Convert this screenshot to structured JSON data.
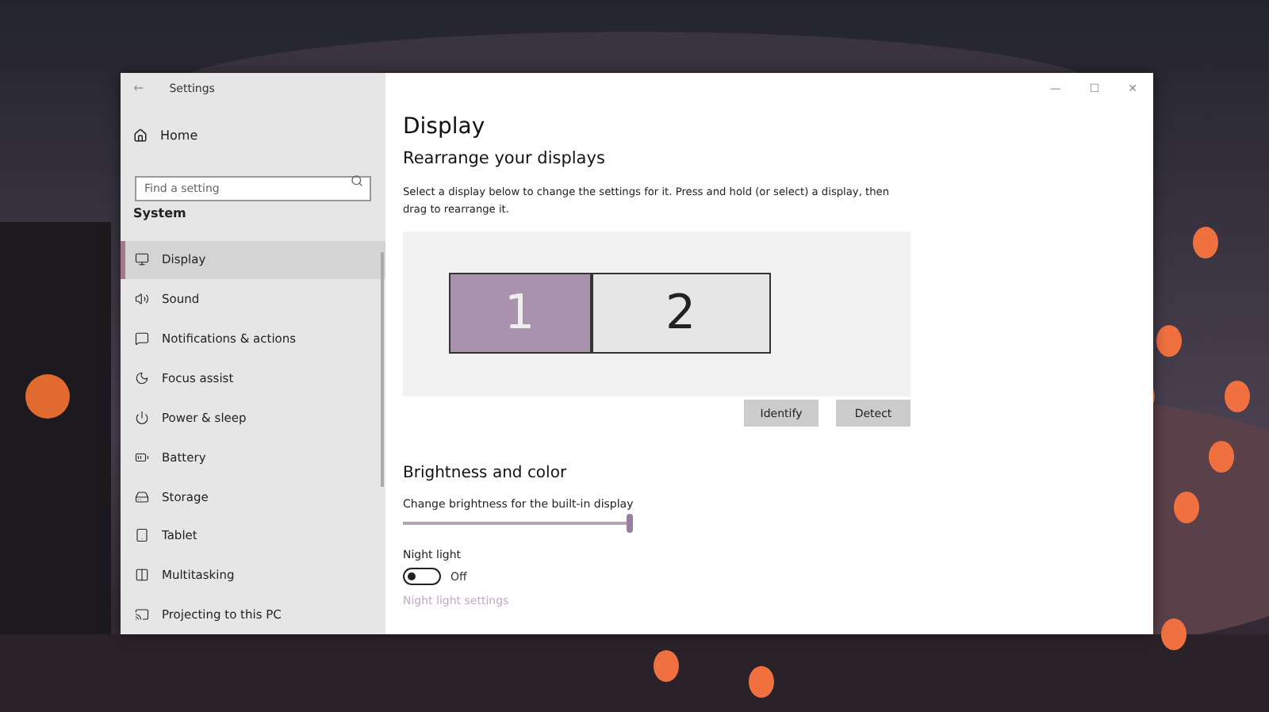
{
  "window": {
    "title": "Settings",
    "back": "←",
    "controls": [
      "—",
      "☐",
      "✕"
    ]
  },
  "sidebar": {
    "home": "Home",
    "search": {
      "placeholder": "Find a setting"
    },
    "section": "System",
    "items": [
      {
        "label": "Display",
        "selected": true
      },
      {
        "label": "Sound",
        "selected": false
      },
      {
        "label": "Notifications & actions",
        "selected": false
      },
      {
        "label": "Focus assist",
        "selected": false
      },
      {
        "label": "Power & sleep",
        "selected": false
      },
      {
        "label": "Battery",
        "selected": false
      },
      {
        "label": "Storage",
        "selected": false
      },
      {
        "label": "Tablet",
        "selected": false
      },
      {
        "label": "Multitasking",
        "selected": false
      },
      {
        "label": "Projecting to this PC",
        "selected": false
      }
    ]
  },
  "content": {
    "title": "Display",
    "rearrange": {
      "heading": "Rearrange your displays",
      "description": "Select a display below to change the settings for it. Press and hold (or select) a display, then drag to rearrange it.",
      "displays": [
        {
          "label": "1",
          "selected": true
        },
        {
          "label": "2",
          "selected": false
        }
      ],
      "buttons": [
        "Identify",
        "Detect"
      ]
    },
    "brightness": {
      "heading": "Brightness and color",
      "slider_label": "Change brightness for the built-in display",
      "level": 1.0,
      "night_light": {
        "label": "Night light",
        "on": false,
        "state_text": "Off"
      },
      "link": "Night light settings"
    }
  }
}
